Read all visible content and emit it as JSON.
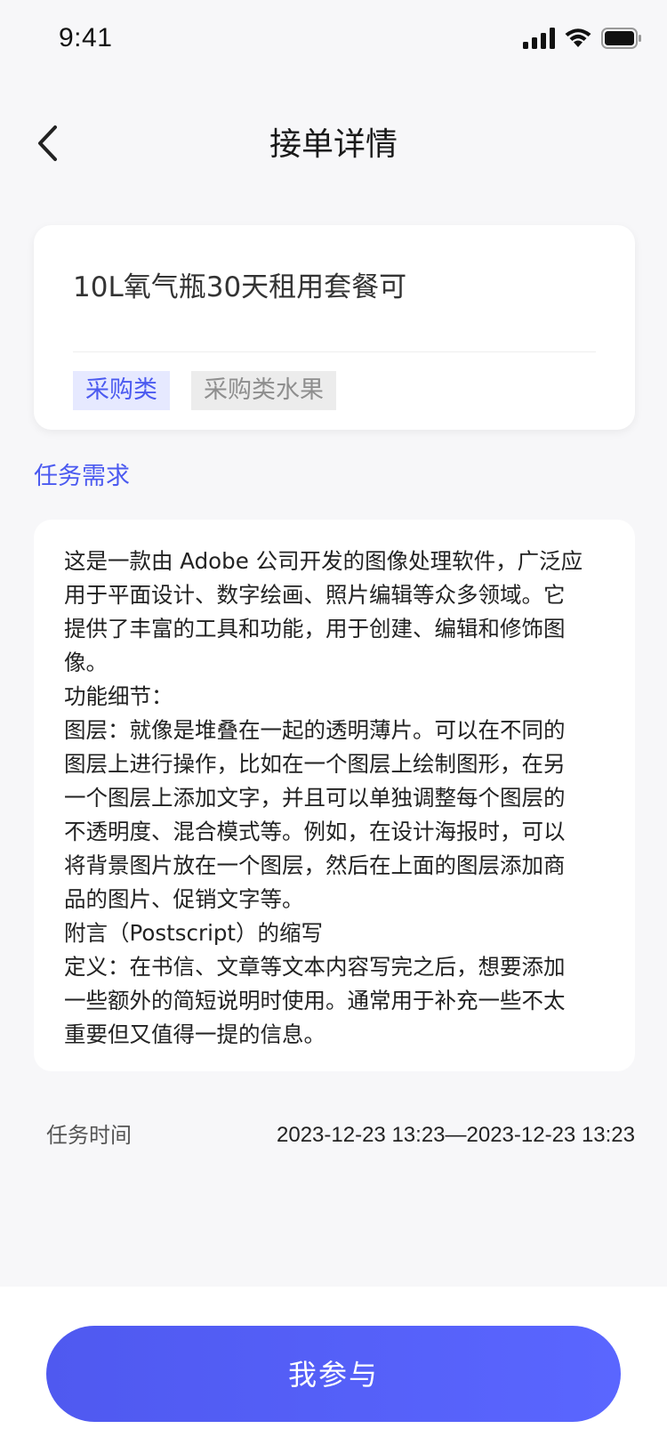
{
  "status_bar": {
    "time": "9:41",
    "icons": [
      "signal-icon",
      "wifi-icon",
      "battery-icon"
    ]
  },
  "header": {
    "title": "接单详情",
    "back_icon": "chevron-left-icon"
  },
  "task": {
    "title": "10L氧气瓶30天租用套餐可",
    "tags": [
      "采购类",
      "采购类水果"
    ]
  },
  "requirements": {
    "heading": "任务需求",
    "lines": [
      "这是一款由 Adobe 公司开发的图像处理软件，广泛应",
      "用于平面设计、数字绘画、照片编辑等众多领域。它",
      "提供了丰富的工具和功能，用于创建、编辑和修饰图",
      "像。",
      "功能细节：",
      "图层：就像是堆叠在一起的透明薄片。可以在不同的",
      "图层上进行操作，比如在一个图层上绘制图形，在另",
      "一个图层上添加文字，并且可以单独调整每个图层的",
      "不透明度、混合模式等。例如，在设计海报时，可以",
      "将背景图片放在一个图层，然后在上面的图层添加商",
      "品的图片、促销文字等。",
      "附言（Postscript）的缩写",
      "定义：在书信、文章等文本内容写完之后，想要添加",
      "一些额外的简短说明时使用。通常用于补充一些不太",
      "重要但又值得一提的信息。"
    ]
  },
  "time_row": {
    "label": "任务时间",
    "value": "2023-12-23 13:23—2023-12-23 13:23"
  },
  "action": {
    "join_label": "我参与"
  },
  "colors": {
    "accent": "#4b5af0",
    "tag_primary_bg": "#e6e9ff",
    "tag_secondary_bg": "#ececec",
    "page_bg": "#f7f7f9"
  }
}
